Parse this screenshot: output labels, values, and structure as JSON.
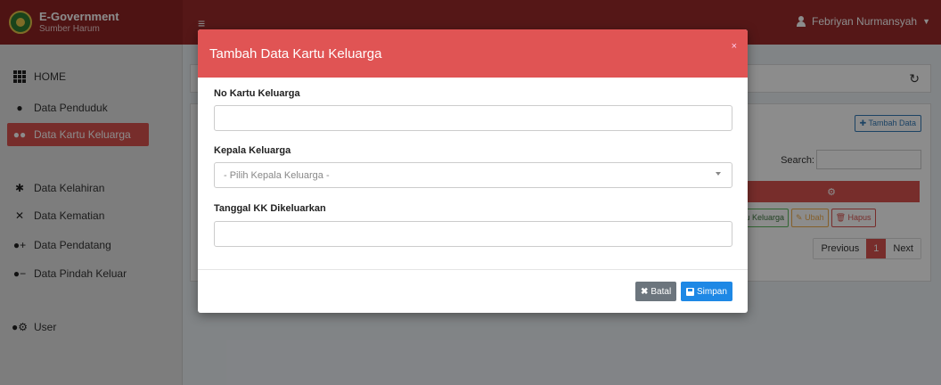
{
  "app": {
    "title": "E-Government",
    "subtitle": "Sumber Harum"
  },
  "header": {
    "menu_icon": "hamburger-icon",
    "user_name": "Febriyan Nurmansyah"
  },
  "sidebar": {
    "items": [
      {
        "label": "HOME",
        "icon": "grid-icon"
      },
      {
        "label": "Data Penduduk",
        "icon": "user-icon"
      },
      {
        "label": "Data Kartu Keluarga",
        "icon": "users-icon"
      },
      {
        "label": "Data Kelahiran",
        "icon": "baby-icon"
      },
      {
        "label": "Data Kematian",
        "icon": "user-slash-icon"
      },
      {
        "label": "Data Pendatang",
        "icon": "user-plus-icon"
      },
      {
        "label": "Data Pindah Keluar",
        "icon": "user-minus-icon"
      },
      {
        "label": "User",
        "icon": "user-cog-icon"
      }
    ],
    "active": "Data Kartu Keluarga"
  },
  "background": {
    "tambah_label": "Tambah Data",
    "search_label": "Search:",
    "row_actions": {
      "kk_label": "rtu Keluarga",
      "ubah_label": "Ubah",
      "hapus_label": "Hapus"
    },
    "pager": {
      "previous": "Previous",
      "current": "1",
      "next": "Next"
    }
  },
  "modal": {
    "title": "Tambah Data Kartu Keluarga",
    "close": "×",
    "fields": {
      "no_kk_label": "No Kartu Keluarga",
      "no_kk_value": "",
      "kepala_label": "Kepala Keluarga",
      "kepala_placeholder": "- Pilih Kepala Keluarga -",
      "tanggal_label": "Tanggal KK Dikeluarkan",
      "tanggal_value": ""
    },
    "buttons": {
      "batal": "Batal",
      "simpan": "Simpan"
    }
  },
  "colors": {
    "topbar": "#9c2b2b",
    "accent_red": "#d9534f",
    "modal_header": "#e05454",
    "primary": "#1e88e5",
    "secondary": "#6c757d"
  }
}
